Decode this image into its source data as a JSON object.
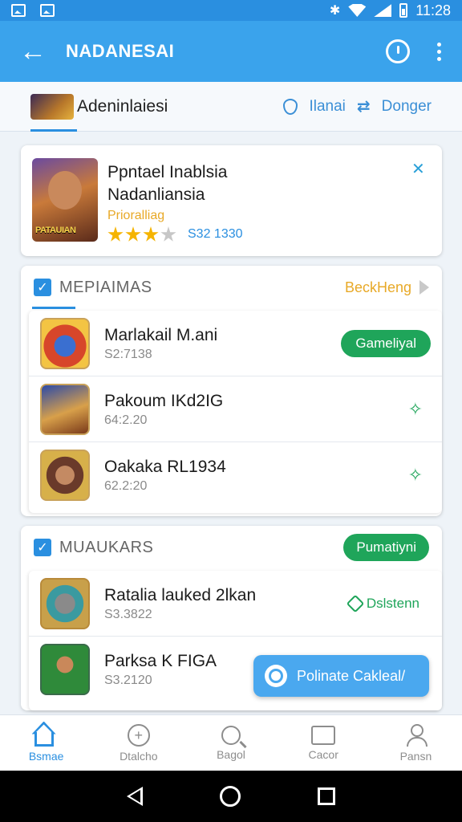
{
  "status_bar": {
    "time": "11:28"
  },
  "app_bar": {
    "title": "NADANESAI"
  },
  "tab_strip": {
    "label": "Adeninlaiesi",
    "link_1": "Ilanai",
    "link_2": "Donger"
  },
  "featured": {
    "title_line1": "Ppntael Inablsia",
    "title_line2": "Nadanliansia",
    "subtitle": "Prioralliag",
    "rating": 3,
    "rating_max": 5,
    "rating_count": "S32 1330"
  },
  "section1": {
    "title": "MEPIAIMAS",
    "link": "BeckHeng",
    "items": [
      {
        "title": "Marlakail M.ani",
        "sub": "S2:7138",
        "action": "Gameliyal"
      },
      {
        "title": "Pakoum IKd2IG",
        "sub": "64:2.20"
      },
      {
        "title": "Oakaka RL1934",
        "sub": "62.2:20"
      }
    ]
  },
  "section2": {
    "title": "MUAUKARS",
    "action": "Pumatiyni",
    "items": [
      {
        "title": "Ratalia lauked 2lkan",
        "sub": "S3.3822",
        "action": "Dslstenn"
      },
      {
        "title": "Parksa K FIGA",
        "sub": "S3.2120"
      }
    ]
  },
  "fab": {
    "label": "Polinate Cakleal/"
  },
  "bottom_nav": {
    "items": [
      {
        "label": "Bsmae",
        "icon": "home-icon"
      },
      {
        "label": "Dtalcho",
        "icon": "plus-circle-icon"
      },
      {
        "label": "Bagol",
        "icon": "search-icon"
      },
      {
        "label": "Cacor",
        "icon": "folder-icon"
      },
      {
        "label": "Pansn",
        "icon": "user-icon"
      }
    ]
  },
  "colors": {
    "primary": "#3aa3ec",
    "accent_green": "#1fa55a",
    "accent_orange": "#e8a927"
  }
}
